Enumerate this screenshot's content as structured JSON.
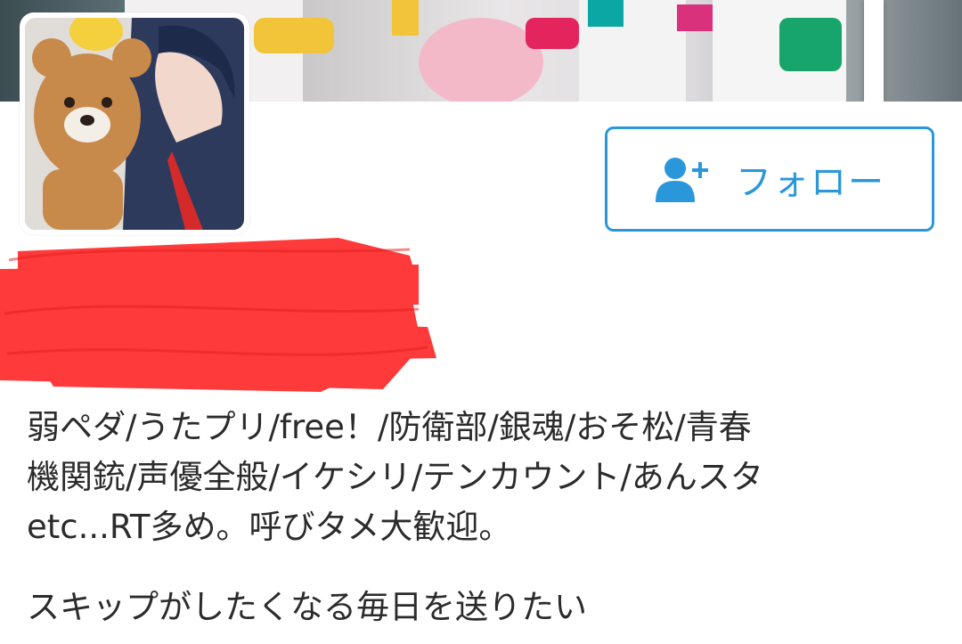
{
  "profile": {
    "follow_button": {
      "label": "フォロー",
      "icon": "add-user-icon"
    },
    "bio_lines": [
      "弱ペダ/うたプリ/free！/防衛部/銀魂/おそ松/青春",
      "機関銃/声優全般/イケシリ/テンカウント/あんスタ",
      "etc...RT多め。呼びタメ大歓迎。"
    ],
    "bio_second": "スキップがしたくなる毎日を送りたい"
  },
  "colors": {
    "accent": "#2a97db",
    "text": "#2b2b2b",
    "redaction": "#ff2a2a"
  }
}
